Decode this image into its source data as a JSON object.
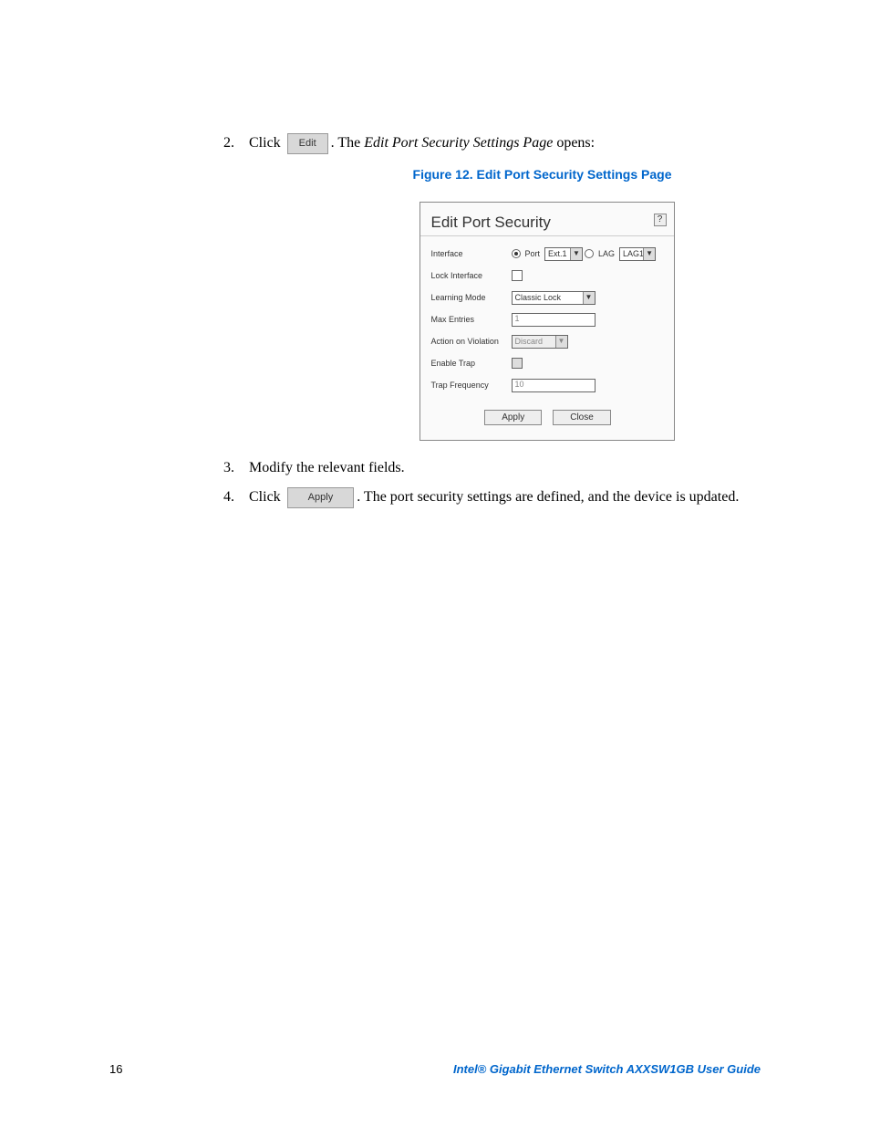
{
  "steps": {
    "s2": {
      "num": "2.",
      "verb": "Click",
      "btn": "Edit",
      "rest1": ". The ",
      "em": "Edit Port Security Settings Page",
      "rest2": " opens:"
    },
    "s3": {
      "num": "3.",
      "text": "Modify the relevant fields."
    },
    "s4": {
      "num": "4.",
      "verb": "Click",
      "btn": "Apply",
      "rest": ". The port security settings are defined, and the device is updated."
    }
  },
  "figure_caption": "Figure 12. Edit Port Security Settings Page",
  "dialog": {
    "title": "Edit Port Security",
    "help": "?",
    "labels": {
      "interface": "Interface",
      "lock_interface": "Lock Interface",
      "learning_mode": "Learning Mode",
      "max_entries": "Max Entries",
      "action_on_violation": "Action on Violation",
      "enable_trap": "Enable Trap",
      "trap_frequency": "Trap Frequency"
    },
    "interface": {
      "port_label": "Port",
      "port_value": "Ext.1",
      "lag_label": "LAG",
      "lag_value": "LAG1"
    },
    "learning_mode": "Classic Lock",
    "max_entries": "1",
    "action_on_violation": "Discard",
    "trap_frequency": "10",
    "buttons": {
      "apply": "Apply",
      "close": "Close"
    }
  },
  "footer": {
    "page": "16",
    "title": "Intel® Gigabit Ethernet Switch AXXSW1GB User Guide"
  }
}
